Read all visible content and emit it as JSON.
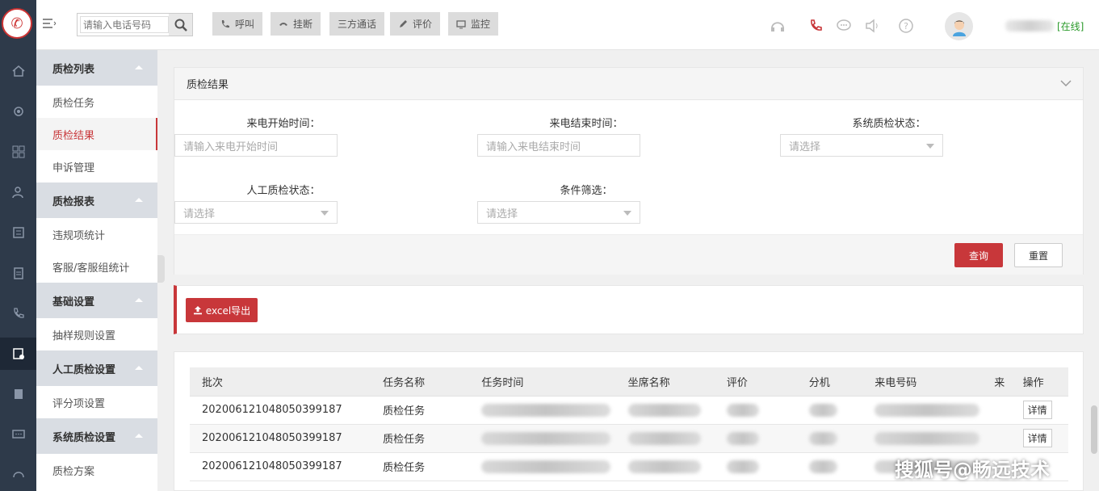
{
  "search": {
    "placeholder": "请输入电话号码"
  },
  "toolbar": {
    "call": "呼叫",
    "hangup": "挂断",
    "three_way": "三方通话",
    "evaluate": "评价",
    "monitor": "监控"
  },
  "user": {
    "status": "[在线]"
  },
  "sidebar": {
    "groups": [
      {
        "title": "质检列表",
        "items": [
          "质检任务",
          "质检结果",
          "申诉管理"
        ]
      },
      {
        "title": "质检报表",
        "items": [
          "违规项统计",
          "客服/客服组统计"
        ]
      },
      {
        "title": "基础设置",
        "items": [
          "抽样规则设置"
        ]
      },
      {
        "title": "人工质检设置",
        "items": [
          "评分项设置"
        ]
      },
      {
        "title": "系统质检设置",
        "items": [
          "质检方案"
        ]
      }
    ]
  },
  "filter": {
    "title": "质检结果",
    "start_label": "来电开始时间：",
    "start_placeholder": "请输入来电开始时间",
    "end_label": "来电结束时间：",
    "end_placeholder": "请输入来电结束时间",
    "sys_status_label": "系统质检状态：",
    "sys_status_value": "请选择",
    "manual_status_label": "人工质检状态：",
    "manual_status_value": "请选择",
    "condition_label": "条件筛选：",
    "condition_value": "请选择",
    "query_button": "查询",
    "reset_button": "重置"
  },
  "export": {
    "button": "excel导出"
  },
  "table": {
    "headers": [
      "批次",
      "任务名称",
      "任务时间",
      "坐席名称",
      "评价",
      "分机",
      "来电号码",
      "来",
      "操作"
    ],
    "rows": [
      {
        "batch": "20200612104805039918​7",
        "task": "质检任务",
        "action": "详情"
      },
      {
        "batch": "202006121048050399187",
        "task": "质检任务",
        "action": "详情"
      },
      {
        "batch": "202006121048050399187",
        "task": "质检任务",
        "action": ""
      }
    ]
  },
  "watermark": "搜狐号@畅远技术"
}
